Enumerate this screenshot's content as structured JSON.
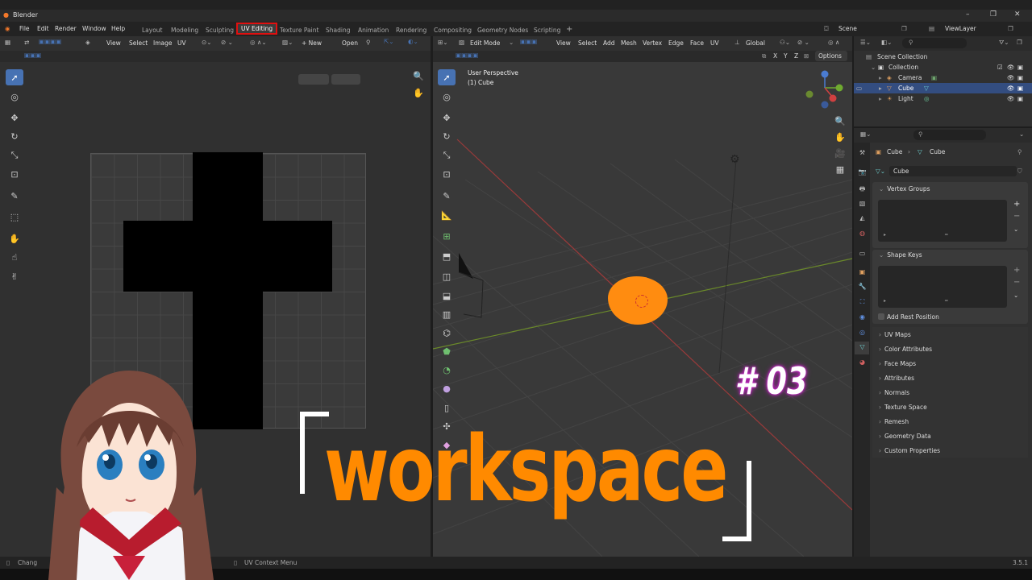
{
  "window": {
    "title": "Blender"
  },
  "menu": [
    "File",
    "Edit",
    "Render",
    "Window",
    "Help"
  ],
  "workspaces": [
    "Layout",
    "Modeling",
    "Sculpting",
    "UV Editing",
    "Texture Paint",
    "Shading",
    "Animation",
    "Rendering",
    "Compositing",
    "Geometry Nodes",
    "Scripting",
    "+"
  ],
  "active_workspace": "UV Editing",
  "scene": {
    "name": "Scene",
    "view_layer": "ViewLayer"
  },
  "uv_editor": {
    "menus": [
      "View",
      "Select",
      "Image",
      "UV"
    ],
    "new_label": "+ New",
    "open_label": "Open"
  },
  "viewport": {
    "mode": "Edit Mode",
    "menus": [
      "View",
      "Select",
      "Add",
      "Mesh",
      "Vertex",
      "Edge",
      "Face",
      "UV"
    ],
    "orientation": "Global",
    "axes": [
      "X",
      "Y",
      "Z"
    ],
    "options_label": "Options",
    "overlay_title": "User Perspective",
    "overlay_sub": "(1) Cube"
  },
  "outliner": {
    "root": "Scene Collection",
    "collection": "Collection",
    "items": [
      "Camera",
      "Cube",
      "Light"
    ]
  },
  "properties": {
    "breadcrumb_object": "Cube",
    "breadcrumb_mesh": "Cube",
    "mesh_name": "Cube",
    "sections_open": [
      "Vertex Groups",
      "Shape Keys"
    ],
    "add_rest_position": "Add Rest Position",
    "sections": [
      "UV Maps",
      "Color Attributes",
      "Face Maps",
      "Attributes",
      "Normals",
      "Texture Space",
      "Remesh",
      "Geometry Data",
      "Custom Properties"
    ]
  },
  "statusbar": {
    "left": "Chang",
    "context_menu": "UV Context Menu",
    "version": "3.5.1"
  },
  "overlay_text": {
    "title": "workspace",
    "episode": "# 03"
  },
  "colors": {
    "accent": "#4772b3",
    "orange": "#ff8a00",
    "active_tab_border": "#e01010"
  }
}
